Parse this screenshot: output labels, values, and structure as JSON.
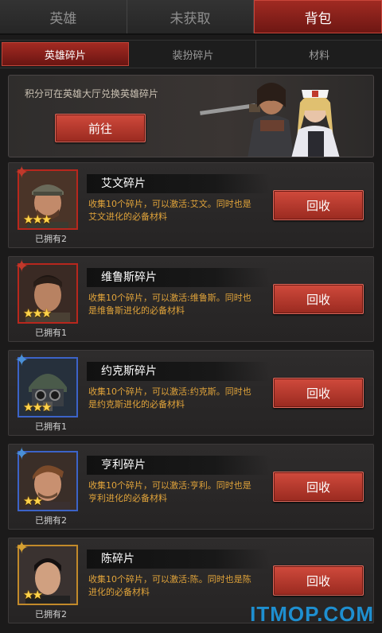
{
  "top_tabs": [
    {
      "label": "英雄"
    },
    {
      "label": "未获取"
    },
    {
      "label": "背包"
    }
  ],
  "sub_tabs": [
    {
      "label": "英雄碎片"
    },
    {
      "label": "装扮碎片"
    },
    {
      "label": "材料"
    }
  ],
  "banner": {
    "text": "积分可在英雄大厅兑换英雄碎片",
    "button_label": "前往"
  },
  "items": [
    {
      "name": "艾文碎片",
      "desc_line1": "收集10个碎片，可以激活:艾文。同时也是",
      "desc_line2": "艾文进化的必备材料",
      "owned": "已拥有2",
      "button": "回收",
      "stars": "★★★",
      "frame_color": "#b8271d"
    },
    {
      "name": "维鲁斯碎片",
      "desc_line1": "收集10个碎片，可以激活:维鲁斯。同时也",
      "desc_line2": "是维鲁斯进化的必备材料",
      "owned": "已拥有1",
      "button": "回收",
      "stars": "★★★",
      "frame_color": "#b8271d"
    },
    {
      "name": "约克斯碎片",
      "desc_line1": "收集10个碎片，可以激活:约克斯。同时也",
      "desc_line2": "是约克斯进化的必备材料",
      "owned": "已拥有1",
      "button": "回收",
      "stars": "★★★",
      "frame_color": "#3c63c8"
    },
    {
      "name": "亨利碎片",
      "desc_line1": "收集10个碎片，可以激活:亨利。同时也是",
      "desc_line2": "亨利进化的必备材料",
      "owned": "已拥有2",
      "button": "回收",
      "stars": "★★",
      "frame_color": "#3c63c8"
    },
    {
      "name": "陈碎片",
      "desc_line1": "收集10个碎片，可以激活:陈。同时也是陈",
      "desc_line2": "进化的必备材料",
      "owned": "已拥有2",
      "button": "回收",
      "stars": "★★",
      "frame_color": "#c28a2a"
    }
  ],
  "watermark": "ITMOP.COM"
}
